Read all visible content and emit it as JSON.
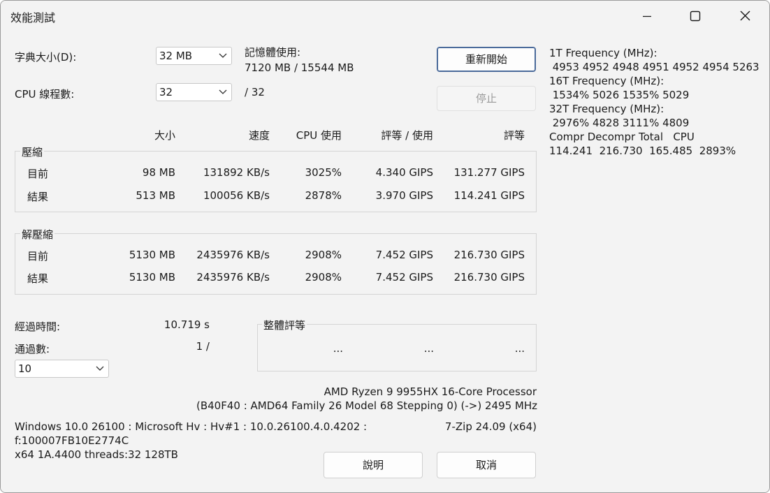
{
  "window": {
    "title": "效能測試"
  },
  "settings": {
    "dict_label": "字典大小(D):",
    "dict_value": "32 MB",
    "threads_label": "CPU 線程數:",
    "threads_value": "32",
    "threads_max": "/ 32",
    "memory_label": "記憶體使用:",
    "memory_value": "7120 MB / 15544 MB"
  },
  "buttons": {
    "restart": "重新開始",
    "stop": "停止",
    "help": "說明",
    "cancel": "取消"
  },
  "headers": {
    "size": "大小",
    "speed": "速度",
    "cpu_usage": "CPU 使用",
    "rating_usage": "評等 / 使用",
    "rating": "評等"
  },
  "compress": {
    "title": "壓縮",
    "rows": [
      {
        "label": "目前",
        "size": "98 MB",
        "speed": "131892 KB/s",
        "cpu": "3025%",
        "rpu": "4.340 GIPS",
        "rating": "131.277 GIPS"
      },
      {
        "label": "結果",
        "size": "513 MB",
        "speed": "100056 KB/s",
        "cpu": "2878%",
        "rpu": "3.970 GIPS",
        "rating": "114.241 GIPS"
      }
    ]
  },
  "decompress": {
    "title": "解壓縮",
    "rows": [
      {
        "label": "目前",
        "size": "5130 MB",
        "speed": "2435976 KB/s",
        "cpu": "2908%",
        "rpu": "7.452 GIPS",
        "rating": "216.730 GIPS"
      },
      {
        "label": "結果",
        "size": "5130 MB",
        "speed": "2435976 KB/s",
        "cpu": "2908%",
        "rpu": "7.452 GIPS",
        "rating": "216.730 GIPS"
      }
    ]
  },
  "status": {
    "elapsed_label": "經過時間:",
    "elapsed_value": "10.719 s",
    "passes_label": "通過數:",
    "passes_value": "1 /",
    "passes_select": "10"
  },
  "total": {
    "title": "整體評等",
    "v1": "...",
    "v2": "...",
    "v3": "..."
  },
  "cpu_info": {
    "line1": "AMD Ryzen 9 9955HX 16-Core Processor",
    "line2": "(B40F40 : AMD64 Family 26 Model 68 Stepping 0) (->) 2495 MHz"
  },
  "sys_info": {
    "line1": "Windows 10.0 26100 : Microsoft Hv : Hv#1 : 10.0.26100.4.0.4202 :",
    "line2": "f:100007FB10E2774C",
    "line3": "x64 1A.4400 threads:32 128TB",
    "version": "7-Zip 24.09 (x64)"
  },
  "freq": {
    "l1": "1T Frequency (MHz):",
    "l2": " 4953 4952 4948 4951 4952 4954 5263",
    "l3": "16T Frequency (MHz):",
    "l4": " 1534% 5026 1535% 5029",
    "l5": "32T Frequency (MHz):",
    "l6": " 2976% 4828 3111% 4809",
    "l7": "Compr Decompr Total   CPU",
    "l8": "114.241  216.730  165.485  2893%"
  }
}
